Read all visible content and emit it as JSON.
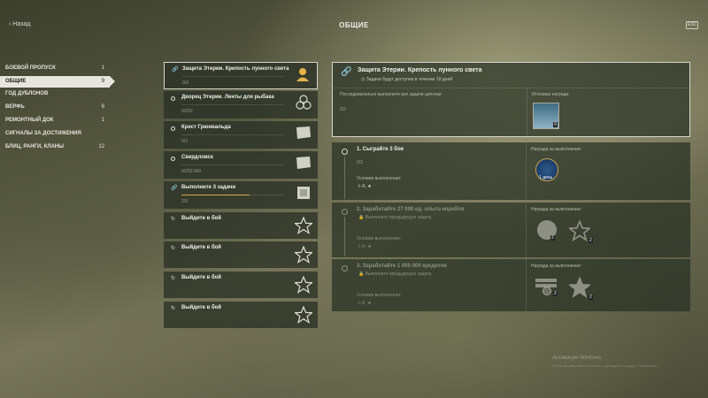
{
  "header": {
    "back_label": "Назад",
    "title": "ОБЩИЕ",
    "key_hint": "ESC"
  },
  "sidebar": {
    "items": [
      {
        "label": "БОЕВОЙ ПРОПУСК",
        "count": "1"
      },
      {
        "label": "ОБЩИЕ",
        "count": "9"
      },
      {
        "label": "ГОД ДУБЛОНОВ",
        "count": ""
      },
      {
        "label": "ВЕРФЬ",
        "count": "6"
      },
      {
        "label": "РЕМОНТНЫЙ ДОК",
        "count": "1"
      },
      {
        "label": "СИГНАЛЫ ЗА ДОСТИЖЕНИЯ",
        "count": ""
      },
      {
        "label": "БЛИЦ, РАНГИ, КЛАНЫ",
        "count": "12"
      }
    ]
  },
  "tasks": [
    {
      "name": "Защита Этерии. Крепость лунного света",
      "progress": "0/3",
      "icon": "bust-icon"
    },
    {
      "name": "Дворец Этерии. Ленты для рыбака",
      "progress": "0/250",
      "icon": "emblem-icon"
    },
    {
      "name": "Крест Грюнвальда",
      "progress": "0/3",
      "icon": "flag-icon"
    },
    {
      "name": "Свердловск",
      "progress": "0/250 000",
      "icon": "flag-icon"
    },
    {
      "name": "Выполните 3 задачи",
      "progress": "2/3",
      "progress_fraction": 0.67,
      "icon": "cards-icon"
    },
    {
      "name": "Выйдите в бой",
      "progress": "",
      "icon": "star-icon"
    },
    {
      "name": "Выйдите в бой",
      "progress": "",
      "icon": "star-icon"
    },
    {
      "name": "Выйдите в бой",
      "progress": "",
      "icon": "star-icon"
    },
    {
      "name": "Выйдите в бой",
      "progress": "",
      "icon": "star-icon"
    }
  ],
  "chain": {
    "title": "Защита Этерии. Крепость лунного света",
    "subtitle": "Задачи будут доступна в течение 19 дней",
    "description": "Последовательно выполните все задачи цепочки",
    "progress": "0/3",
    "reward_label": "Итоговая награда:",
    "reward_count": "6"
  },
  "steps": [
    {
      "name": "1. Сыграйте 3 боя",
      "requirement": "",
      "progress": "0/3",
      "conditions_label": "Условия выполнения:",
      "tiers": "I–X, ★",
      "reward_label": "Награда за выполнение:",
      "reward_text": "1 день"
    },
    {
      "name": "2. Заработайте 27 000 ед. опыта корабля",
      "requirement": "Выполните предыдущую задачу",
      "progress": "",
      "conditions_label": "Условия выполнения:",
      "tiers": "I–X, ★",
      "reward_label": "Награда за выполнение:",
      "reward_counts": [
        "2",
        "2"
      ]
    },
    {
      "name": "3. Заработайте 1 000 000 кредитов",
      "requirement": "Выполните предыдущую задачу",
      "progress": "",
      "conditions_label": "Условия выполнения:",
      "tiers": "I–X, ★",
      "reward_label": "Награда за выполнение:",
      "reward_counts": [
        "2",
        "2"
      ]
    }
  ],
  "watermark": {
    "title": "Активация Windows",
    "text": "Чтобы активировать Windows, перейдите в раздел \"Параметры\"."
  }
}
